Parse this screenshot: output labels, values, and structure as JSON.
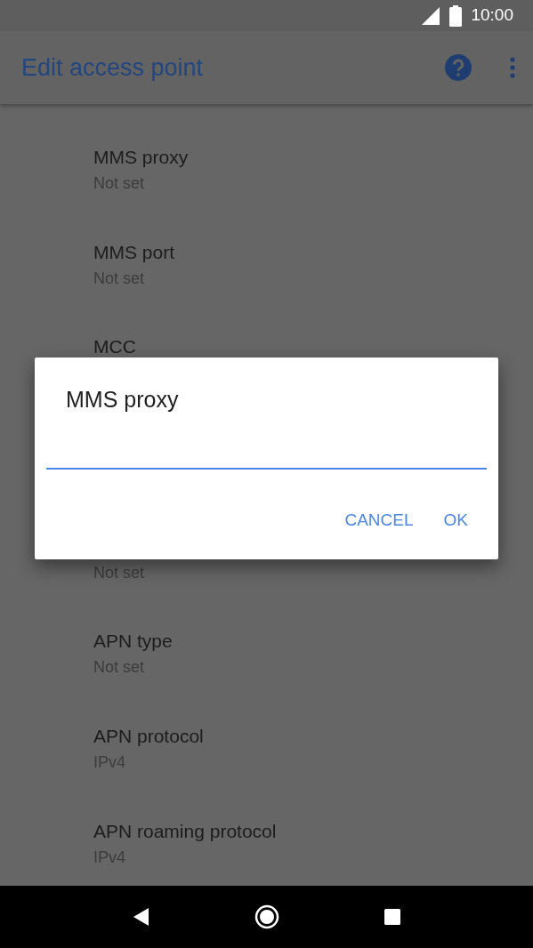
{
  "status_bar": {
    "time": "10:00"
  },
  "app_bar": {
    "title": "Edit access point"
  },
  "settings": [
    {
      "title": "MMS proxy",
      "summary": "Not set"
    },
    {
      "title": "MMS port",
      "summary": "Not set"
    },
    {
      "title": "MCC"
    }
  ],
  "settings_below_dialog": [
    {
      "summary": "Not set"
    },
    {
      "title": "APN type",
      "summary": "Not set"
    },
    {
      "title": "APN protocol",
      "summary": "IPv4"
    },
    {
      "title": "APN roaming protocol",
      "summary": "IPv4"
    }
  ],
  "dialog": {
    "title": "MMS proxy",
    "buttons": [
      "CANCEL",
      "OK"
    ]
  }
}
